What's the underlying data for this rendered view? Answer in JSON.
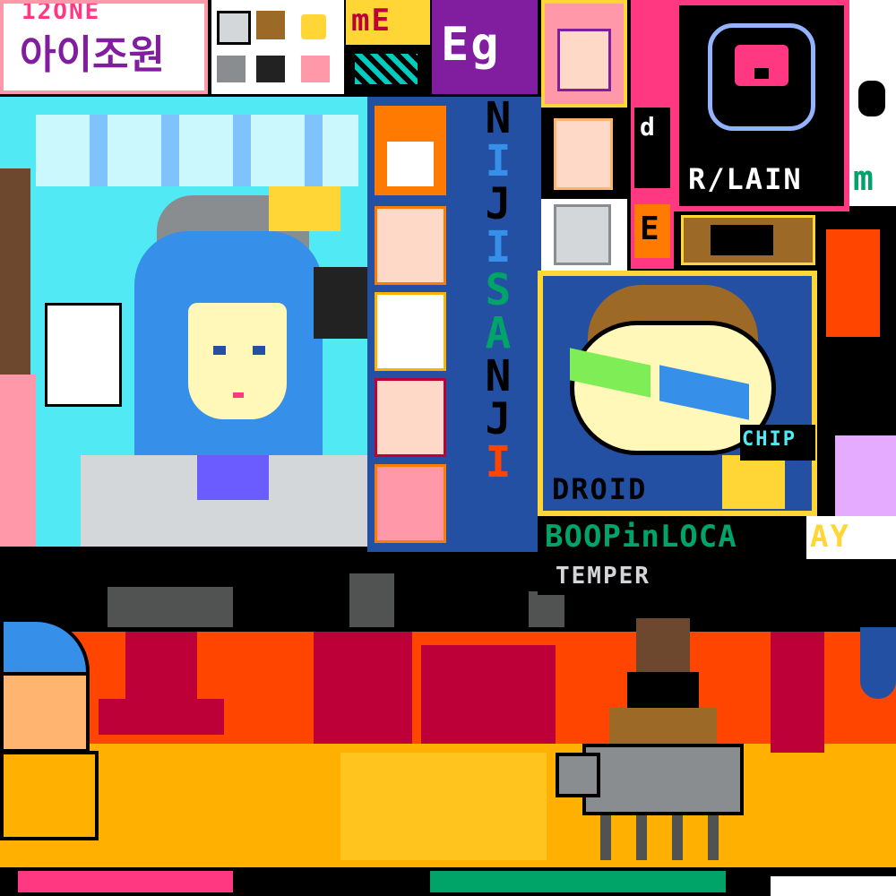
{
  "canvas": {
    "top_left_sign_line1": "12ONE",
    "top_left_sign_line2": "아이조원",
    "me_label": "mE",
    "eg_label": "Eg",
    "lain_label": "R/LAIN",
    "m_label": "m",
    "nijisanji_letters": [
      "N",
      "I",
      "J",
      "I",
      "S",
      "A",
      "N",
      "J",
      "I"
    ],
    "droid_label": "DROID",
    "booper_label": "BOOPinLOCA",
    "ay_label": "AY",
    "temper_label": "TEMPER",
    "chip_label": "CHIP",
    "e_label": "E",
    "small_d_label": "d",
    "small_e_label": "e"
  },
  "colors": {
    "black": "#000000",
    "flag_red": "#ff4500",
    "flag_orange": "#ff7a00",
    "flag_yellow": "#ffb000",
    "mural_red": "#be0039",
    "light_blue": "#51e9f4",
    "teal_blue": "#3690ea",
    "navy": "#2450a4",
    "gray": "#898d90",
    "light_gray": "#d4d7d9",
    "white": "#ffffff",
    "pink": "#ff99aa",
    "magenta": "#de107f",
    "purple": "#811e9f",
    "green": "#00a368",
    "lime": "#7eed56",
    "brown": "#9c6926",
    "tan": "#ffd635"
  },
  "icons": [
    "cat-faces-icon",
    "skull-icon",
    "bear-speech-icon",
    "donkey-icon",
    "dog-icon",
    "sunglasses-icon",
    "torch-icon"
  ]
}
